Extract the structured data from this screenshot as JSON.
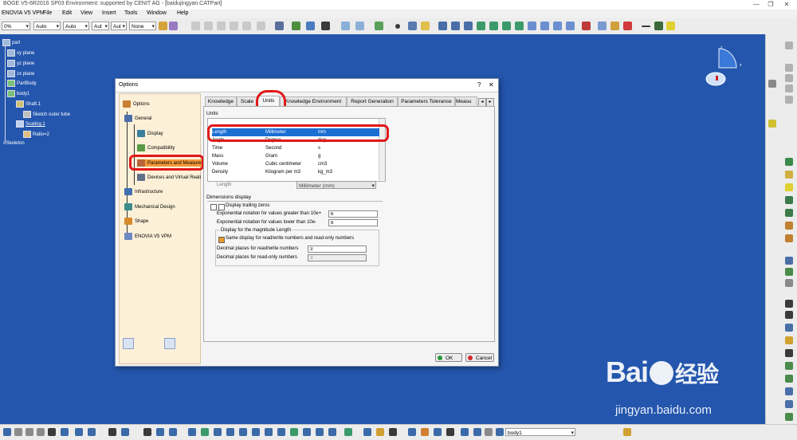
{
  "app": {
    "title": "BOGE V5-6R2016 SP03 Environment: supported by CENIT AG - [baidujingyan.CATPart]",
    "win_min": "—",
    "win_max": "❐",
    "win_close": "✕"
  },
  "menu": [
    "ENOVIA V5 VPM",
    "File",
    "Edit",
    "View",
    "Insert",
    "Tools",
    "Window",
    "Help"
  ],
  "toolbar": {
    "combos": [
      "0%",
      "Auto",
      "Auto",
      "Aut",
      "Aut",
      "None"
    ]
  },
  "tree": [
    {
      "label": "part",
      "indent": 0
    },
    {
      "label": "xy plane",
      "indent": 1
    },
    {
      "label": "yz plane",
      "indent": 1
    },
    {
      "label": "zx plane",
      "indent": 1
    },
    {
      "label": "PartBody",
      "indent": 1
    },
    {
      "label": "body1",
      "indent": 1
    },
    {
      "label": "Shaft.1",
      "indent": 2
    },
    {
      "label": "Sketch outer tube",
      "indent": 3
    },
    {
      "label": "Scaling.1",
      "indent": 2
    },
    {
      "label": "Ratio=2",
      "indent": 3
    },
    {
      "label": "#Skeleton",
      "indent": 1
    }
  ],
  "compass": {
    "x": "x",
    "z": "z"
  },
  "dialog": {
    "title": "Options",
    "help": "?",
    "close": "✕",
    "left_nodes": [
      {
        "label": "Options",
        "color": "#c87f2f"
      },
      {
        "label": "General",
        "color": "#4c6fa8"
      },
      {
        "label": "Display",
        "color": "#3a7f9d"
      },
      {
        "label": "Compatibility",
        "color": "#5b9a44"
      },
      {
        "label": "Parameters and Measure",
        "color": "#b9653a"
      },
      {
        "label": "Devices and Virtual Reali",
        "color": "#5f6f8a"
      },
      {
        "label": "Infrastructure",
        "color": "#3f6fb0"
      },
      {
        "label": "Mechanical Design",
        "color": "#3c8c8a"
      },
      {
        "label": "Shape",
        "color": "#d58b2a"
      },
      {
        "label": "ENOVIA V5 VPM",
        "color": "#6d88c2"
      }
    ],
    "tabs": [
      "Knowledge",
      "Scale",
      "Units",
      "Knowledge Environment",
      "Report Generation",
      "Parameters Tolerance",
      "Measu"
    ],
    "tab_prev": "◂",
    "tab_next": "▸",
    "units_title": "Units",
    "units_rows": [
      {
        "name": "Length",
        "unit": "Millimeter",
        "symbol": "mm",
        "selected": true
      },
      {
        "name": "Angle",
        "unit": "Degree",
        "symbol": "deg"
      },
      {
        "name": "Time",
        "unit": "Second",
        "symbol": "s"
      },
      {
        "name": "Mass",
        "unit": "Gram",
        "symbol": "g"
      },
      {
        "name": "Volume",
        "unit": "Cubic centimeter",
        "symbol": "cm3"
      },
      {
        "name": "Density",
        "unit": "Kilogram per m3",
        "symbol": "kg_m3"
      }
    ],
    "length_label": "Length",
    "length_value": "Millimeter (mm)",
    "dims_title": "Dimensions display",
    "trailing_zeros": "Display trailing zeros",
    "exp_greater_label": "Exponential notation for values greater than 10e+",
    "exp_greater_value": "6",
    "exp_lower_label": "Exponential notation for values lower than 10e-",
    "exp_lower_value": "6",
    "magnitude_title": "Display for the magnitude Length",
    "same_display": "Same display for read/write numbers and read-only numbers",
    "dec_rw_label": "Decimal places for read/write numbers",
    "dec_rw_value": "3",
    "dec_ro_label": "Decimal places for read-only numbers",
    "dec_ro_value": "3",
    "ok": "OK",
    "cancel": "Cancel"
  },
  "bottom": {
    "combo": "body1"
  },
  "watermark": {
    "brand": "Bai",
    "cn": "经验",
    "url": "jingyan.baidu.com"
  },
  "colors": {
    "canvas": "#2456ad",
    "highlight": "#e01818",
    "selection": "#1b6fd3",
    "panel": "#fdf0d8"
  }
}
